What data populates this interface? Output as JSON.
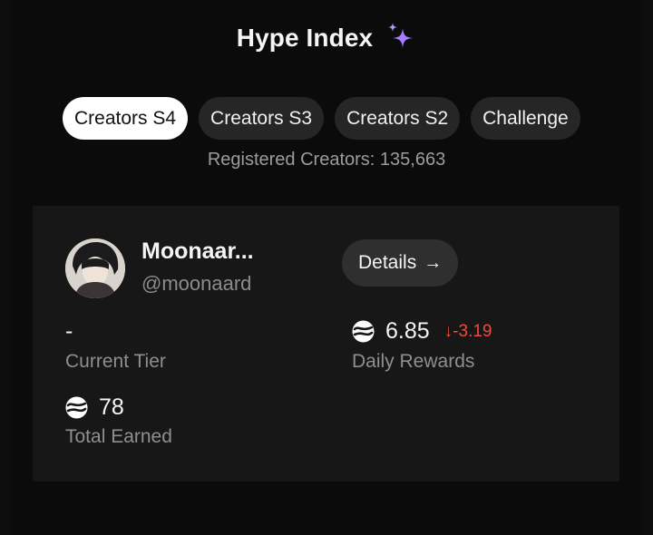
{
  "header": {
    "title": "Hype Index",
    "sparkle_icon": "sparkles-icon"
  },
  "tabs": [
    {
      "label": "Creators S4",
      "active": true
    },
    {
      "label": "Creators S3",
      "active": false
    },
    {
      "label": "Creators S2",
      "active": false
    },
    {
      "label": "Challenge",
      "active": false
    }
  ],
  "registered": "Registered Creators: 135,663",
  "profile": {
    "name": "Moonaar...",
    "handle": "@moonaard",
    "details_label": "Details",
    "details_arrow": "→"
  },
  "stats": {
    "current_tier": {
      "value": "-",
      "label": "Current Tier"
    },
    "daily_rewards": {
      "value": "6.85",
      "delta": "↓-3.19",
      "label": "Daily Rewards"
    },
    "total_earned": {
      "value": "78",
      "label": "Total Earned"
    }
  },
  "colors": {
    "background": "#0b0b0b",
    "card": "#171717",
    "tab": "#262626",
    "tab_active": "#ffffff",
    "accent_sparkle": "#9b6cff",
    "negative": "#ee4b3f"
  }
}
